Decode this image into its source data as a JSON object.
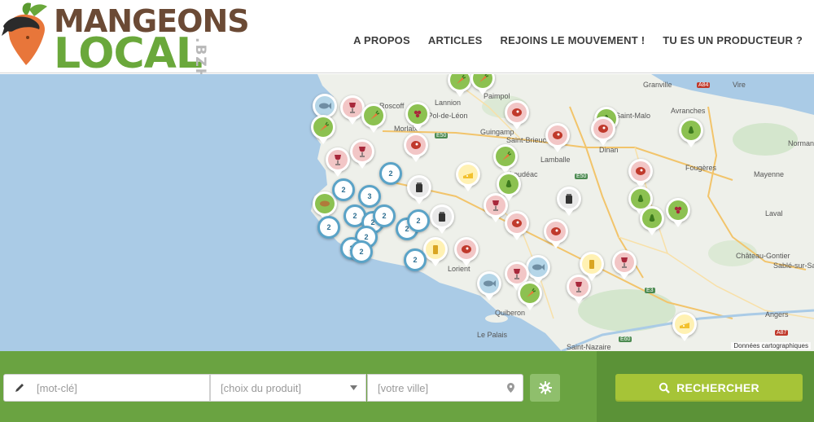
{
  "brand": {
    "line1": "MANGEONS",
    "line2": "LOCAL",
    "tld": ".BZH",
    "colors": {
      "brown": "#6b4a35",
      "green": "#6aa83b",
      "orange": "#e8763a"
    }
  },
  "nav": {
    "items": [
      {
        "label": "A PROPOS"
      },
      {
        "label": "ARTICLES"
      },
      {
        "label": "REJOINS LE MOUVEMENT !"
      },
      {
        "label": "TU ES UN PRODUCTEUR ?"
      }
    ]
  },
  "map": {
    "places": [
      "Lannion",
      "Paimpol",
      "Roscoff",
      "Guingamp",
      "Saint-Brieuc",
      "Lamballe",
      "Dinan",
      "Granville",
      "Avranches",
      "Vire",
      "Fougères",
      "Mayenne",
      "Laval",
      "Loudéac",
      "Lorient",
      "Quiberon",
      "Le Palais",
      "Château-Gontier",
      "Sablé-sur-Sarthe",
      "Angers",
      "Saint-Nazaire",
      "Normandie",
      "Morlaix",
      "Saint-Malo",
      "Saint-Pol-de-Léon"
    ],
    "road_labels": [
      "E50",
      "E50",
      "A84",
      "E3",
      "E60",
      "A87"
    ],
    "attribution": "Données cartographiques",
    "clusters": [
      "2",
      "2",
      "3",
      "2",
      "2",
      "2",
      "2",
      "2",
      "2",
      "2",
      "2",
      "2",
      "2"
    ],
    "marker_icons": [
      "carrot-icon",
      "pear-icon",
      "meat-icon",
      "fish-icon",
      "cheese-icon",
      "wine-icon",
      "jar-icon",
      "grape-icon",
      "bread-icon",
      "cider-icon"
    ]
  },
  "search": {
    "keyword_placeholder": "[mot-clé]",
    "product_placeholder": "[choix du produit]",
    "city_placeholder": "[votre ville]",
    "submit_label": "RECHERCHER"
  }
}
